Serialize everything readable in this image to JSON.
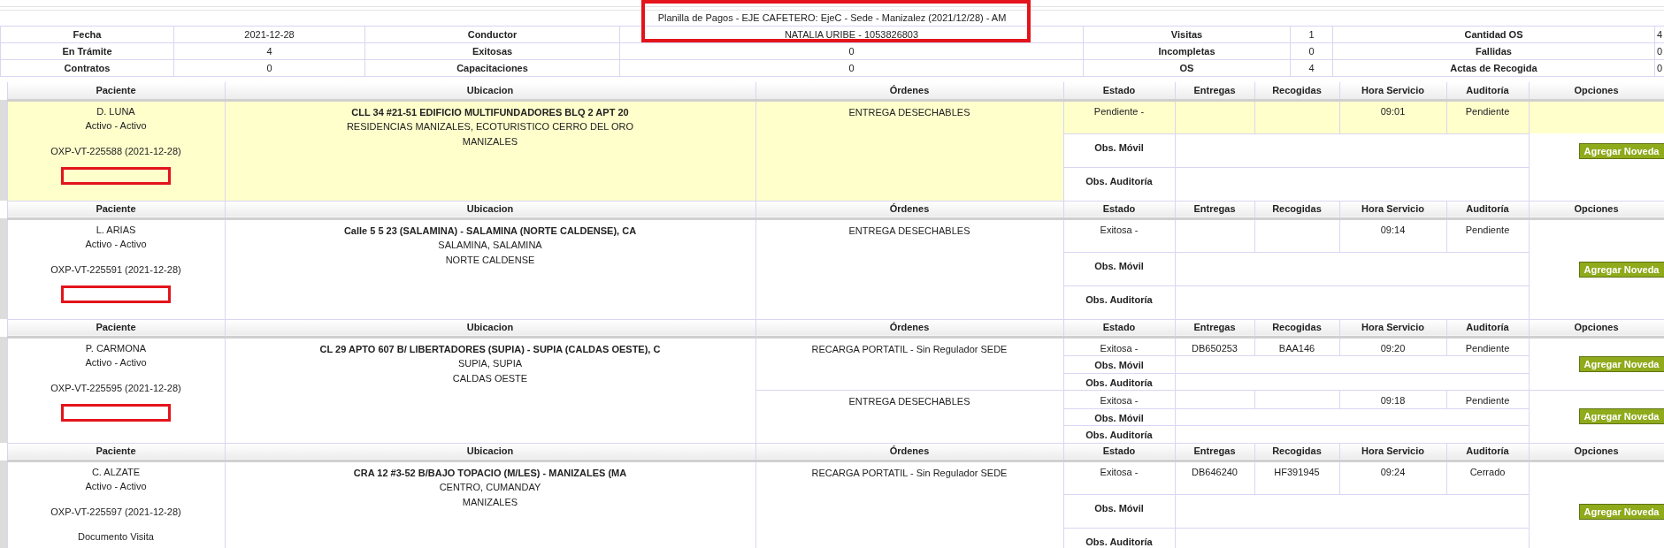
{
  "title": "Planilla de Pagos - EJE CAFETERO: EjeC - Sede - Manizalez (2021/12/28) - AM",
  "title_highlighted": true,
  "summary": [
    [
      {
        "label": "Fecha",
        "value": "2021-12-28"
      },
      {
        "label": "Conductor",
        "value": "NATALIA URIBE - 1053826803"
      },
      {
        "label": "Visitas",
        "value": "1"
      },
      {
        "label": "Cantidad OS",
        "value": "4"
      }
    ],
    [
      {
        "label": "En Trámite",
        "value": "4"
      },
      {
        "label": "Exitosas",
        "value": "0"
      },
      {
        "label": "Incompletas",
        "value": "0"
      },
      {
        "label": "Fallidas",
        "value": "0"
      }
    ],
    [
      {
        "label": "Contratos",
        "value": "0"
      },
      {
        "label": "Capacitaciones",
        "value": "0"
      },
      {
        "label": "OS",
        "value": "4"
      },
      {
        "label": "Actas de Recogida",
        "value": "0"
      }
    ]
  ],
  "visits": [
    {
      "headers": [
        "Paciente",
        "Ubicacion",
        "Órdenes",
        "Estado",
        "Entregas",
        "Recogidas",
        "Hora Servicio",
        "Auditoría",
        "Opciones"
      ],
      "highlighted": true,
      "patient": {
        "name": "D. LUNA",
        "status": "Activo - Activo",
        "code": "OXP-VT-225588 (2021-12-28)",
        "redacted": true
      },
      "address": [
        "CLL 34 #21-51 EDIFICIO MULTIFUNDADORES BLQ 2 APT 20",
        "RESIDENCIAS MANIZALES, ECOTURISTICO CERRO DEL ORO",
        "MANIZALES"
      ],
      "orders": [
        {
          "name": "ENTREGA DESECHABLES",
          "estado": "Pendiente -",
          "hora": "09:01",
          "auditoria": "Pendiente",
          "obs_movil": "Obs. Móvil",
          "obs_auditoria": "Obs. Auditoría",
          "action": "Agregar Noveda"
        }
      ]
    },
    {
      "headers": [
        "Paciente",
        "Ubicacion",
        "Órdenes",
        "Estado",
        "Entregas",
        "Recogidas",
        "Hora Servicio",
        "Auditoría",
        "Opciones"
      ],
      "highlighted": false,
      "patient": {
        "name": "L. ARIAS",
        "status": "Activo - Activo",
        "code": "OXP-VT-225591 (2021-12-28)",
        "redacted": true
      },
      "address": [
        "Calle 5 5 23 (SALAMINA) - SALAMINA (NORTE CALDENSE), CA",
        "SALAMINA, SALAMINA",
        "NORTE CALDENSE"
      ],
      "orders": [
        {
          "name": "ENTREGA DESECHABLES",
          "estado": "Exitosa -",
          "hora": "09:14",
          "auditoria": "Pendiente",
          "obs_movil": "Obs. Móvil",
          "obs_auditoria": "Obs. Auditoría",
          "action": "Agregar Noveda"
        }
      ]
    },
    {
      "headers": [
        "Paciente",
        "Ubicacion",
        "Órdenes",
        "Estado",
        "Entregas",
        "Recogidas",
        "Hora Servicio",
        "Auditoría",
        "Opciones"
      ],
      "highlighted": false,
      "patient": {
        "name": "P. CARMONA",
        "status": "Activo - Activo",
        "code": "OXP-VT-225595 (2021-12-28)",
        "redacted": true
      },
      "address": [
        "CL 29 APTO 607 B/ LIBERTADORES (SUPIA) - SUPIA (CALDAS OESTE), C",
        "SUPIA, SUPIA",
        "CALDAS OESTE"
      ],
      "orders": [
        {
          "name": "RECARGA PORTATIL - Sin Regulador SEDE",
          "estado": "Exitosa -",
          "entregas": "DB650253",
          "recogidas": "BAA146",
          "hora": "09:20",
          "auditoria": "Pendiente",
          "obs_movil": "Obs. Móvil",
          "obs_auditoria": "Obs. Auditoría",
          "action": "Agregar Noveda"
        },
        {
          "name": "ENTREGA DESECHABLES",
          "estado": "Exitosa -",
          "hora": "09:18",
          "auditoria": "Pendiente",
          "obs_movil": "Obs. Móvil",
          "obs_auditoria": "Obs. Auditoría",
          "action": "Agregar Noveda"
        }
      ]
    },
    {
      "headers": [
        "Paciente",
        "Ubicacion",
        "Órdenes",
        "Estado",
        "Entregas",
        "Recogidas",
        "Hora Servicio",
        "Auditoría",
        "Opciones"
      ],
      "highlighted": false,
      "patient": {
        "name": "C. ALZATE",
        "status": "Activo - Activo",
        "code": "OXP-VT-225597 (2021-12-28)",
        "redacted": false,
        "document_link": "Documento Visita"
      },
      "address": [
        "CRA 12 #3-52 B/BAJO TOPACIO (M/LES) - MANIZALES (MA",
        "CENTRO, CUMANDAY",
        "MANIZALES"
      ],
      "orders": [
        {
          "name": "RECARGA PORTATIL - Sin Regulador SEDE",
          "estado": "Exitosa -",
          "entregas": "DB646240",
          "recogidas": "HF391945",
          "hora": "09:24",
          "auditoria": "Cerrado",
          "obs_movil": "Obs. Móvil",
          "obs_auditoria": "Obs. Auditoría",
          "action": "Agregar Noveda"
        }
      ]
    }
  ]
}
